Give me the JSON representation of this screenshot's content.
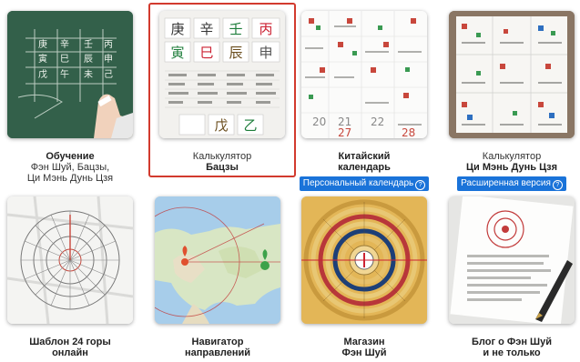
{
  "tiles": [
    {
      "line1": "Обучение",
      "line2": "Фэн Шуй, Бацзы,",
      "line3": "Ци Мэнь Дунь Цзя"
    },
    {
      "line1": "Калькулятор",
      "line2": "Бацзы"
    },
    {
      "line1": "Китайский",
      "line2": "календарь",
      "badge": "Персональный календарь"
    },
    {
      "line1": "Калькулятор",
      "line2": "Ци Мэнь Дунь Цзя",
      "badge": "Расширенная версия"
    },
    {
      "line1": "Шаблон 24 горы",
      "line2": "онлайн"
    },
    {
      "line1": "Навигатор",
      "line2": "направлений"
    },
    {
      "line1": "Магазин",
      "line2": "Фэн Шуй"
    },
    {
      "line1": "Блог о Фэн Шуй",
      "line2": "и не только"
    }
  ],
  "board_chars": [
    "庚",
    "辛",
    "壬",
    "丙",
    "寅",
    "巳",
    "辰",
    "申",
    "戊",
    "午",
    "未",
    "己"
  ],
  "calc_chars": [
    "庚",
    "辛",
    "壬",
    "丙",
    "寅",
    "巳",
    "辰",
    "申",
    "戊",
    "乙"
  ],
  "calendar_numbers": [
    "20",
    "21",
    "22",
    "27",
    "28"
  ],
  "help_glyph": "?",
  "colors": {
    "accent": "#1a73d9",
    "selected": "#d23a2e"
  }
}
